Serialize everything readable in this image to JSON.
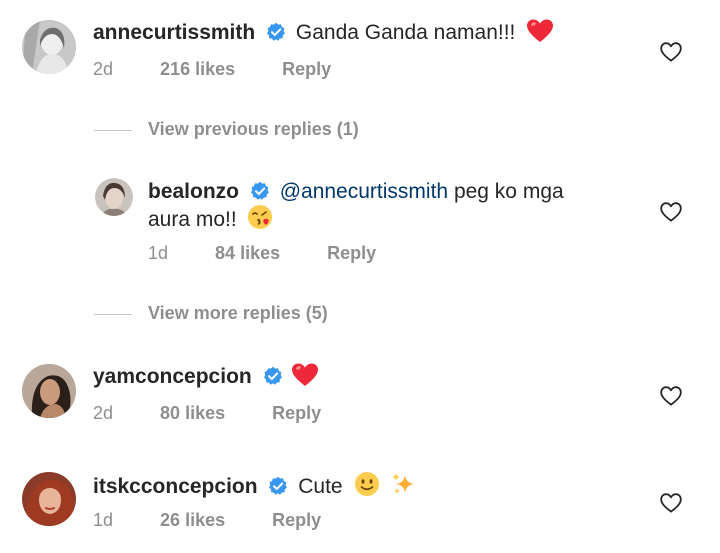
{
  "comments": [
    {
      "username": "annecurtissmith",
      "text": "Ganda Ganda naman!!!",
      "emoji": "red-heart",
      "time": "2d",
      "likes": "216 likes",
      "reply": "Reply"
    },
    {
      "username": "yamconcepcion",
      "text": "",
      "emoji": "red-heart",
      "time": "2d",
      "likes": "80 likes",
      "reply": "Reply"
    },
    {
      "username": "itskcconcepcion",
      "text": "Cute",
      "emoji": "smile-sparkles",
      "time": "1d",
      "likes": "26 likes",
      "reply": "Reply"
    }
  ],
  "view_previous": "View previous replies (1)",
  "reply_comment": {
    "username": "bealonzo",
    "mention": "@annecurtissmith",
    "text_line1": "peg ko mga",
    "text_line2": "aura mo!!",
    "emoji": "kissing-face",
    "time": "1d",
    "likes": "84 likes",
    "reply": "Reply"
  },
  "view_more": "View more replies (5)",
  "colors": {
    "verified": "#3897f0",
    "secondary_text": "#8e8e8e",
    "primary_text": "#262626",
    "heart_emoji": "#ed2939"
  }
}
